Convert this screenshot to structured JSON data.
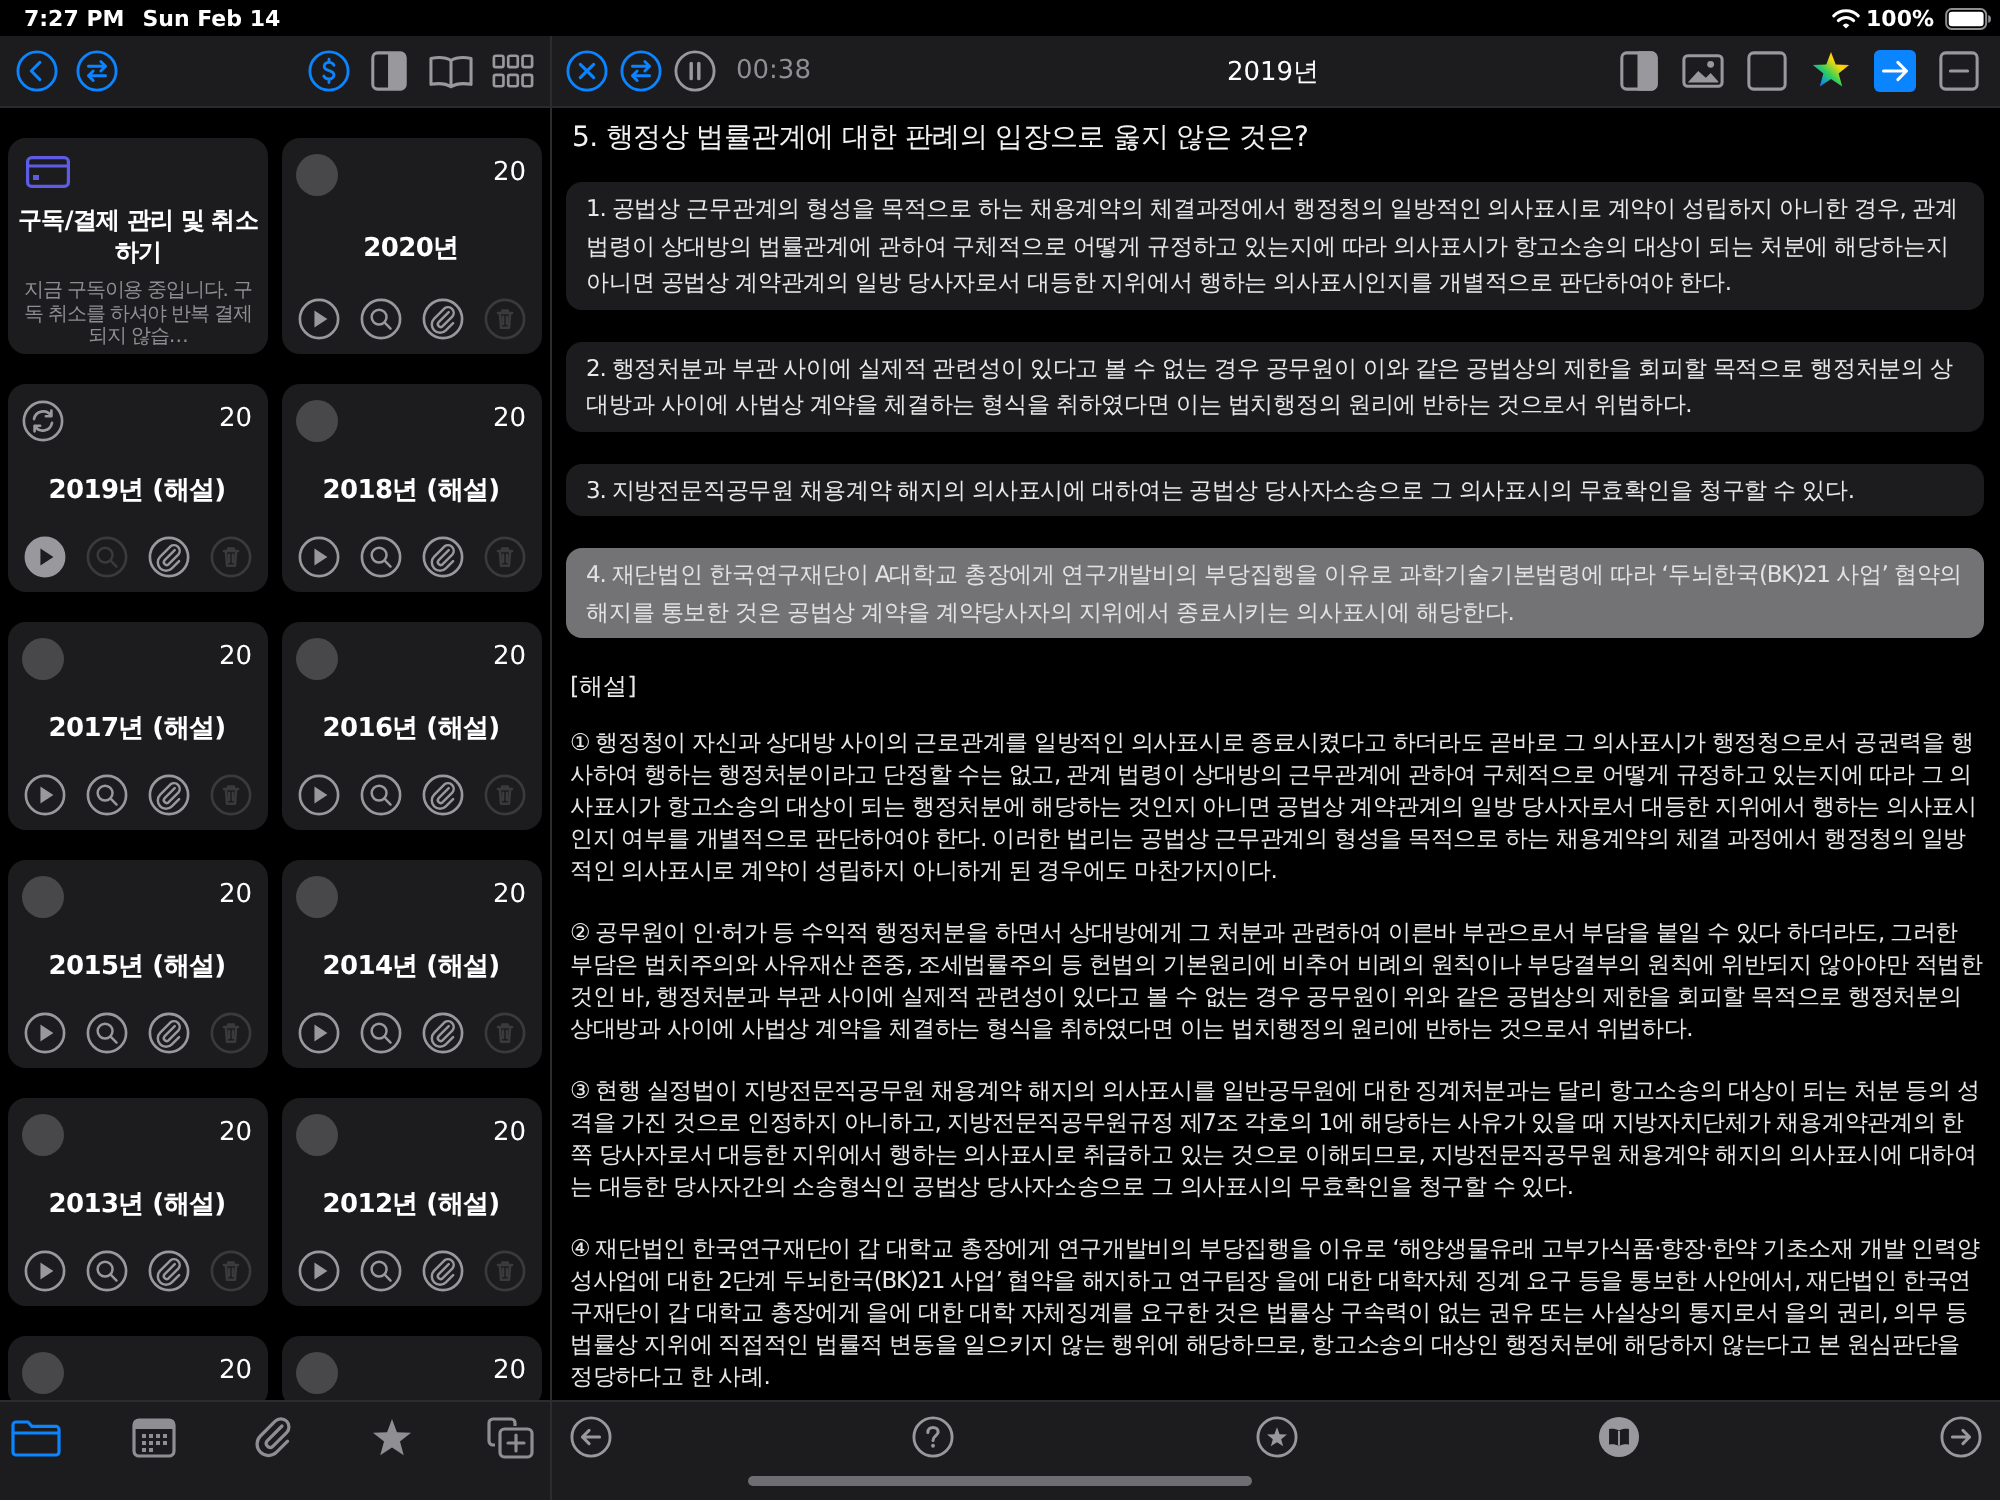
{
  "status_bar": {
    "time": "7:27 PM",
    "date": "Sun Feb 14",
    "battery": "100%"
  },
  "sidebar": {
    "subscription": {
      "title": "구독/결제 관리 및 취소하기",
      "description": "지금 구독이용 중입니다. 구독 취소를 하셔야 반복 결제되지 않습…"
    },
    "exams": [
      {
        "in_progress": false,
        "count": "20",
        "title": "2020년",
        "actions": [
          {
            "kind": "play",
            "on": false,
            "disabled": false
          },
          {
            "kind": "search",
            "on": false,
            "disabled": false
          },
          {
            "kind": "attach",
            "on": false,
            "disabled": false
          },
          {
            "kind": "delete",
            "on": false,
            "disabled": true
          }
        ]
      },
      {
        "in_progress": true,
        "count": "20",
        "title": "2019년 (해설)",
        "actions": [
          {
            "kind": "play",
            "on": true,
            "disabled": false
          },
          {
            "kind": "search",
            "on": false,
            "disabled": true
          },
          {
            "kind": "attach",
            "on": false,
            "disabled": false
          },
          {
            "kind": "delete",
            "on": false,
            "disabled": true
          }
        ]
      },
      {
        "in_progress": false,
        "count": "20",
        "title": "2018년 (해설)",
        "actions": [
          {
            "kind": "play",
            "on": false,
            "disabled": false
          },
          {
            "kind": "search",
            "on": false,
            "disabled": false
          },
          {
            "kind": "attach",
            "on": false,
            "disabled": false
          },
          {
            "kind": "delete",
            "on": false,
            "disabled": true
          }
        ]
      },
      {
        "in_progress": false,
        "count": "20",
        "title": "2017년 (해설)",
        "actions": [
          {
            "kind": "play",
            "on": false,
            "disabled": false
          },
          {
            "kind": "search",
            "on": false,
            "disabled": false
          },
          {
            "kind": "attach",
            "on": false,
            "disabled": false
          },
          {
            "kind": "delete",
            "on": false,
            "disabled": true
          }
        ]
      },
      {
        "in_progress": false,
        "count": "20",
        "title": "2016년 (해설)",
        "actions": [
          {
            "kind": "play",
            "on": false,
            "disabled": false
          },
          {
            "kind": "search",
            "on": false,
            "disabled": false
          },
          {
            "kind": "attach",
            "on": false,
            "disabled": false
          },
          {
            "kind": "delete",
            "on": false,
            "disabled": true
          }
        ]
      },
      {
        "in_progress": false,
        "count": "20",
        "title": "2015년 (해설)",
        "actions": [
          {
            "kind": "play",
            "on": false,
            "disabled": false
          },
          {
            "kind": "search",
            "on": false,
            "disabled": false
          },
          {
            "kind": "attach",
            "on": false,
            "disabled": false
          },
          {
            "kind": "delete",
            "on": false,
            "disabled": true
          }
        ]
      },
      {
        "in_progress": false,
        "count": "20",
        "title": "2014년 (해설)",
        "actions": [
          {
            "kind": "play",
            "on": false,
            "disabled": false
          },
          {
            "kind": "search",
            "on": false,
            "disabled": false
          },
          {
            "kind": "attach",
            "on": false,
            "disabled": false
          },
          {
            "kind": "delete",
            "on": false,
            "disabled": true
          }
        ]
      },
      {
        "in_progress": false,
        "count": "20",
        "title": "2013년 (해설)",
        "actions": [
          {
            "kind": "play",
            "on": false,
            "disabled": false
          },
          {
            "kind": "search",
            "on": false,
            "disabled": false
          },
          {
            "kind": "attach",
            "on": false,
            "disabled": false
          },
          {
            "kind": "delete",
            "on": false,
            "disabled": true
          }
        ]
      },
      {
        "in_progress": false,
        "count": "20",
        "title": "2012년 (해설)",
        "actions": [
          {
            "kind": "play",
            "on": false,
            "disabled": false
          },
          {
            "kind": "search",
            "on": false,
            "disabled": false
          },
          {
            "kind": "attach",
            "on": false,
            "disabled": false
          },
          {
            "kind": "delete",
            "on": false,
            "disabled": true
          }
        ]
      },
      {
        "in_progress": false,
        "count": "20"
      },
      {
        "in_progress": false,
        "count": "20"
      }
    ],
    "tabs": [
      {
        "kind": "folder",
        "selected": true
      },
      {
        "kind": "calendar",
        "selected": false
      },
      {
        "kind": "attachments",
        "selected": false
      },
      {
        "kind": "favorites",
        "selected": false
      },
      {
        "kind": "add",
        "selected": false
      }
    ]
  },
  "reader": {
    "timer": "00:38",
    "title": "2019년",
    "tools": [
      {
        "kind": "panel",
        "selected": false
      },
      {
        "kind": "image",
        "selected": false
      },
      {
        "kind": "blank",
        "selected": false
      },
      {
        "kind": "star",
        "selected": false
      },
      {
        "kind": "next",
        "selected": true
      },
      {
        "kind": "collapse",
        "selected": false
      }
    ],
    "question": "5. 행정상 법률관계에 대한 판례의 입장으로 옳지 않은 것은?",
    "options": [
      {
        "text": "1. 공법상 근무관계의 형성을 목적으로 하는 채용계약의 체결과정에서 행정청의 일방적인 의사표시로 계약이 성립하지 아니한 경우, 관계 법령이 상대방의 법률관계에 관하여 구체적으로 어떻게 규정하고 있는지에 따라 의사표시가 항고소송의 대상이 되는 처분에 해당하는지 아니면 공법상 계약관계의 일방 당사자로서 대등한 지위에서 행하는 의사표시인지를 개별적으로 판단하여야 한다.",
        "selected": false
      },
      {
        "text": "2. 행정처분과 부관 사이에 실제적 관련성이 있다고 볼 수 없는 경우 공무원이 이와 같은 공법상의 제한을 회피할 목적으로 행정처분의 상대방과 사이에 사법상 계약을 체결하는 형식을 취하였다면 이는 법치행정의 원리에 반하는 것으로서 위법하다.",
        "selected": false
      },
      {
        "text": "3. 지방전문직공무원 채용계약 해지의 의사표시에 대하여는 공법상 당사자소송으로 그 의사표시의 무효확인을 청구할 수 있다.",
        "selected": false
      },
      {
        "text": "4. 재단법인 한국연구재단이 A대학교 총장에게 연구개발비의 부당집행을 이유로 과학기술기본법령에 따라 ‘두뇌한국(BK)21 사업’ 협약의 해지를 통보한 것은 공법상 계약을 계약당사자의 지위에서 종료시키는 의사표시에 해당한다.",
        "selected": true
      }
    ],
    "explanation": {
      "heading": "[해설]",
      "paragraphs": [
        "① 행정청이 자신과 상대방 사이의 근로관계를 일방적인 의사표시로 종료시켰다고 하더라도 곧바로 그 의사표시가 행정청으로서 공권력을 행사하여 행하는 행정처분이라고 단정할 수는 없고, 관계 법령이 상대방의 근무관계에 관하여 구체적으로 어떻게 규정하고 있는지에 따라 그 의사표시가 항고소송의 대상이 되는 행정처분에 해당하는 것인지 아니면 공법상 계약관계의 일방 당사자로서 대등한 지위에서 행하는 의사표시인지 여부를 개별적으로 판단하여야 한다. 이러한 법리는 공법상 근무관계의 형성을 목적으로 하는 채용계약의 체결 과정에서 행정청의 일방적인 의사표시로 계약이 성립하지 아니하게 된 경우에도 마찬가지이다.",
        "② 공무원이 인·허가 등 수익적 행정처분을 하면서 상대방에게 그 처분과 관련하여 이른바 부관으로서 부담을 붙일 수 있다 하더라도, 그러한 부담은 법치주의와 사유재산 존중, 조세법률주의 등 헌법의 기본원리에 비추어 비례의 원칙이나 부당결부의 원칙에 위반되지 않아야만 적법한 것인 바, 행정처분과 부관 사이에 실제적 관련성이 있다고 볼 수 없는 경우 공무원이 위와 같은 공법상의 제한을 회피할 목적으로 행정처분의 상대방과 사이에 사법상 계약을 체결하는 형식을 취하였다면 이는 법치행정의 원리에 반하는 것으로서 위법하다.",
        "③ 현행 실정법이 지방전문직공무원 채용계약 해지의 의사표시를 일반공무원에 대한 징계처분과는 달리 항고소송의 대상이 되는 처분 등의 성격을 가진 것으로 인정하지 아니하고, 지방전문직공무원규정 제7조 각호의 1에 해당하는 사유가 있을 때 지방자치단체가 채용계약관계의 한쪽 당사자로서 대등한 지위에서 행하는 의사표시로 취급하고 있는 것으로 이해되므로, 지방전문직공무원 채용계약 해지의 의사표시에 대하여는 대등한 당사자간의 소송형식인 공법상 당사자소송으로 그 의사표시의 무효확인을 청구할 수 있다.",
        "④ 재단법인 한국연구재단이 갑 대학교 총장에게 연구개발비의 부당집행을 이유로 ‘해양생물유래 고부가식품·향장·한약 기초소재 개발 인력양성사업에 대한 2단계 두뇌한국(BK)21 사업’ 협약을 해지하고 연구팀장 을에 대한 대학자체 징계 요구 등을 통보한 사안에서, 재단법인 한국연구재단이 갑 대학교 총장에게 을에 대한 대학 자체징계를 요구한 것은 법률상 구속력이 없는 권유 또는 사실상의 통지로서 을의 권리, 의무 등 법률상 지위에 직접적인 법률적 변동을 일으키지 않는 행위에 해당하므로, 항고소송의 대상인 행정처분에 해당하지 않는다고 본 원심판단을 정당하다고 한 사례."
      ]
    }
  }
}
